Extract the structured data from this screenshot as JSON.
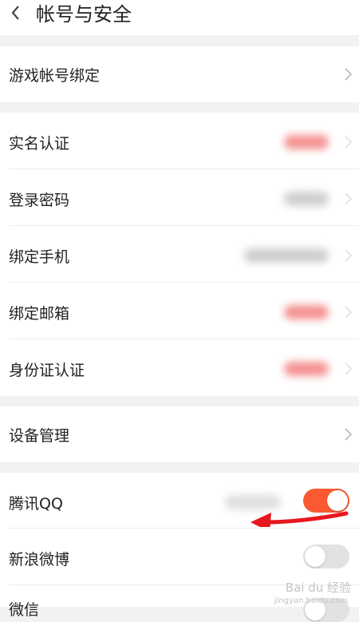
{
  "header": {
    "title": "帐号与安全"
  },
  "game_section": {
    "items": [
      {
        "label": "游戏帐号绑定"
      }
    ]
  },
  "security_section": {
    "items": [
      {
        "label": "实名认证"
      },
      {
        "label": "登录密码"
      },
      {
        "label": "绑定手机"
      },
      {
        "label": "绑定邮箱"
      },
      {
        "label": "身份证认证"
      }
    ]
  },
  "device_section": {
    "items": [
      {
        "label": "设备管理"
      }
    ]
  },
  "social_section": {
    "items": [
      {
        "label": "腾讯QQ",
        "toggle": "on"
      },
      {
        "label": "新浪微博",
        "toggle": "off"
      },
      {
        "label": "微信",
        "toggle": "off"
      }
    ]
  },
  "watermark": {
    "text": "Bai du 经验",
    "sub": "jingyan.baidu.com"
  },
  "colors": {
    "accent": "#fa5a32",
    "arrow": "#e8161e",
    "background": "#f2f2f2"
  }
}
